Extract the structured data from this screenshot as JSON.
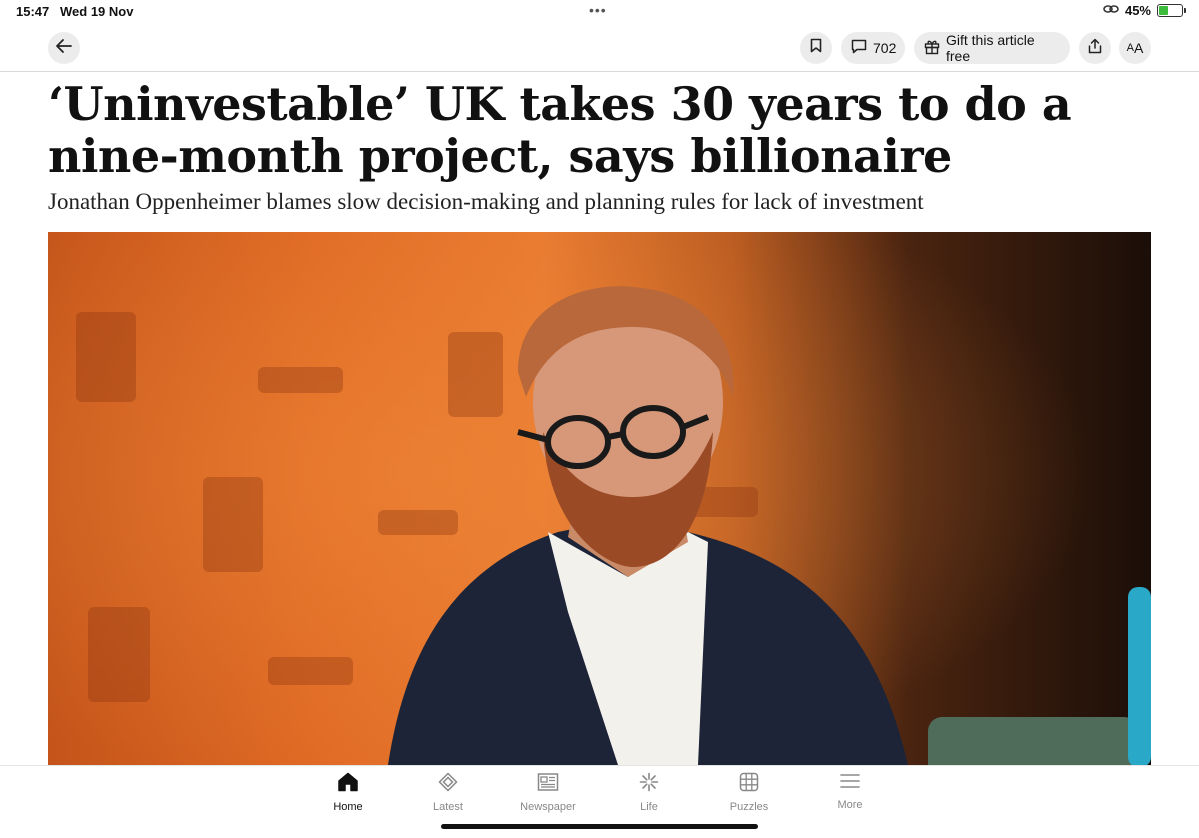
{
  "status": {
    "time": "15:47",
    "date": "Wed 19 Nov",
    "battery_percent": "45%",
    "battery_level": 0.45
  },
  "toolbar": {
    "back_icon": "back-arrow-icon",
    "bookmark_icon": "bookmark-icon",
    "comments_count": "702",
    "gift_label": "Gift this article free",
    "share_icon": "share-icon",
    "text_size_label_small": "A",
    "text_size_label_large": "A"
  },
  "article": {
    "headline": "‘Uninvestable’ UK takes 30 years to do a nine-month project, says billionaire",
    "standfirst": "Jonathan Oppenheimer blames slow decision-making and planning rules for lack of investment",
    "hero_image_description_icon": "photo-icon"
  },
  "tabbar": {
    "items": [
      {
        "label": "Home",
        "icon": "home-icon",
        "active": true
      },
      {
        "label": "Latest",
        "icon": "latest-icon",
        "active": false
      },
      {
        "label": "Newspaper",
        "icon": "newspaper-icon",
        "active": false
      },
      {
        "label": "Life",
        "icon": "life-icon",
        "active": false
      },
      {
        "label": "Puzzles",
        "icon": "puzzles-icon",
        "active": false
      },
      {
        "label": "More",
        "icon": "menu-icon",
        "active": false
      }
    ]
  },
  "colors": {
    "button_bg": "#ececec",
    "battery_green": "#3dbb3d"
  }
}
